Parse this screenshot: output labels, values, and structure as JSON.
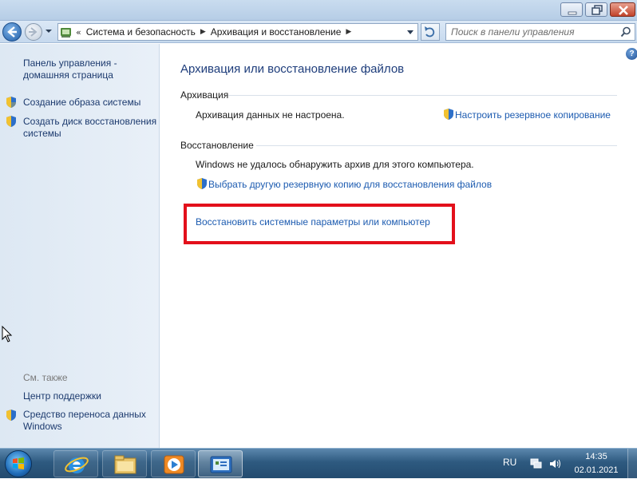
{
  "address": {
    "more_glyph": "«",
    "breadcrumb": [
      {
        "label": "Система и безопасность"
      },
      {
        "label": "Архивация и восстановление"
      }
    ],
    "search_placeholder": "Поиск в панели управления"
  },
  "sidebar": {
    "home_link": "Панель управления - домашняя страница",
    "tasks": [
      {
        "label": "Создание образа системы",
        "icon": "uac-shield-icon"
      },
      {
        "label": "Создать диск восстановления системы",
        "icon": "uac-shield-icon"
      }
    ],
    "see_also_title": "См. также",
    "see_also": [
      {
        "label": "Центр поддержки"
      },
      {
        "label": "Средство переноса данных Windows",
        "icon": "uac-shield-icon"
      }
    ]
  },
  "main": {
    "title": "Архивация или восстановление файлов",
    "backup": {
      "heading": "Архивация",
      "status": "Архивация данных не настроена.",
      "setup_link": "Настроить резервное копирование"
    },
    "restore": {
      "heading": "Восстановление",
      "status": "Windows не удалось обнаружить архив для этого компьютера.",
      "select_backup_link": "Выбрать другую резервную копию для восстановления файлов",
      "restore_system_link": "Восстановить системные параметры или компьютер"
    },
    "help_glyph": "?"
  },
  "taskbar": {
    "pinned": [
      "internet-explorer-icon",
      "windows-explorer-icon",
      "media-player-icon"
    ],
    "active": "control-panel-icon",
    "language": "RU",
    "time": "14:35",
    "date": "02.01.2021"
  },
  "colors": {
    "link": "#1c5bb0",
    "title": "#1e3d7b",
    "highlight": "#e3101b"
  }
}
